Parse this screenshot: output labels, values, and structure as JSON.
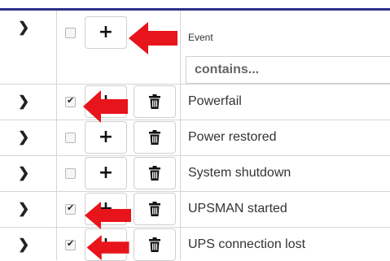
{
  "header": {
    "column_label": "Event",
    "filter_placeholder": "contains...",
    "select_all_checked": false
  },
  "rows": [
    {
      "event": "Powerfail",
      "checked": true
    },
    {
      "event": "Power restored",
      "checked": false
    },
    {
      "event": "System shutdown",
      "checked": false
    },
    {
      "event": "UPSMAN started",
      "checked": true
    },
    {
      "event": "UPS connection lost",
      "checked": true
    }
  ],
  "icons": {
    "expand": "chevron-right-icon",
    "add": "plus-icon",
    "delete": "trash-icon",
    "annotation": "red-arrow-icon"
  },
  "colors": {
    "annotation_arrow": "#e8141b",
    "top_border": "#2f2f8a",
    "grid_line": "#d6d6d6"
  }
}
